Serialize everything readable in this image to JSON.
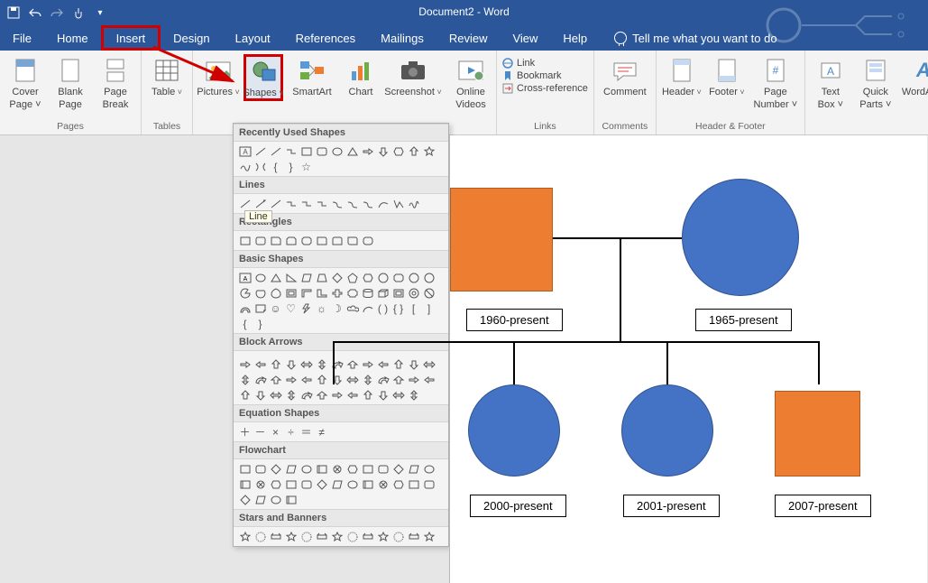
{
  "titlebar": {
    "title": "Document2 - Word",
    "qat": {
      "save": "save-icon",
      "undo": "undo-icon",
      "redo": "redo-icon",
      "touch": "touch-mode-icon"
    }
  },
  "menu": {
    "file": "File",
    "home": "Home",
    "insert": "Insert",
    "design": "Design",
    "layout": "Layout",
    "references": "References",
    "mailings": "Mailings",
    "review": "Review",
    "view": "View",
    "help": "Help",
    "tellme": "Tell me what you want to do"
  },
  "ribbon": {
    "pages": {
      "label": "Pages",
      "cover": "Cover",
      "cover2": "Page ˅",
      "blank": "Blank",
      "blank2": "Page",
      "break": "Page",
      "break2": "Break"
    },
    "tables": {
      "label": "Tables",
      "table": "Table"
    },
    "illust": {
      "pictures": "Pictures",
      "shapes": "Shapes",
      "smartart": "SmartArt",
      "chart": "Chart",
      "screenshot": "Screenshot"
    },
    "media": {
      "online": "Online",
      "videos": "Videos"
    },
    "links": {
      "label": "Links",
      "link": "Link",
      "bookmark": "Bookmark",
      "crossref": "Cross-reference"
    },
    "comments": {
      "label": "Comments",
      "comment": "Comment"
    },
    "headerfooter": {
      "label": "Header & Footer",
      "header": "Header",
      "footer": "Footer",
      "pagenum": "Page",
      "pagenum2": "Number ˅"
    },
    "text": {
      "textbox": "Text",
      "textbox2": "Box ˅",
      "quick": "Quick",
      "quick2": "Parts ˅",
      "wordart": "WordArt"
    }
  },
  "shapes_panel": {
    "recently": "Recently Used Shapes",
    "lines": "Lines",
    "line_tooltip": "Line",
    "rectangles": "Rectangles",
    "basic": "Basic Shapes",
    "block": "Block Arrows",
    "equation": "Equation Shapes",
    "flowchart": "Flowchart",
    "stars": "Stars and Banners"
  },
  "doc": {
    "cap1": "1960-present",
    "cap2": "1965-present",
    "cap3": "2000-present",
    "cap4": "2001-present",
    "cap5": "2007-present"
  }
}
